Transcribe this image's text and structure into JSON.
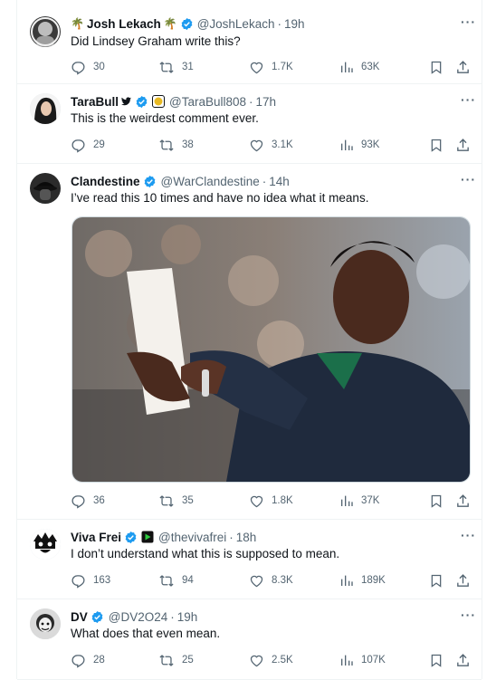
{
  "tweets": [
    {
      "name": "Josh Lekach",
      "name_prefix_emoji": "🌴",
      "name_suffix_emoji": "🌴",
      "handle": "@JoshLekach",
      "time": "19h",
      "text": "Did Lindsey Graham write this?",
      "replies": "30",
      "retweets": "31",
      "likes": "1.7K",
      "views": "63K"
    },
    {
      "name": "TaraBull",
      "handle": "@TaraBull808",
      "time": "17h",
      "text": "This is the weirdest comment ever.",
      "replies": "29",
      "retweets": "38",
      "likes": "3.1K",
      "views": "93K"
    },
    {
      "name": "Clandestine",
      "handle": "@WarClandestine",
      "time": "14h",
      "text": "I’ve read this 10 times and have no idea what it means.",
      "replies": "36",
      "retweets": "35",
      "likes": "1.8K",
      "views": "37K"
    },
    {
      "name": "Viva Frei",
      "handle": "@thevivafrei",
      "time": "18h",
      "text": "I don’t understand what this is supposed to mean.",
      "replies": "163",
      "retweets": "94",
      "likes": "8.3K",
      "views": "189K"
    },
    {
      "name": "DV",
      "handle": "@DV2O24",
      "time": "19h",
      "text": "What does that even mean.",
      "replies": "28",
      "retweets": "25",
      "likes": "2.5K",
      "views": "107K"
    }
  ],
  "separator": "·",
  "more_label": "···",
  "colors": {
    "verified_blue": "#1d9bf0",
    "gold_badge": "#e8b923",
    "text_secondary": "#536471",
    "border": "#eff3f4"
  },
  "icons": {
    "reply": "reply-icon",
    "retweet": "retweet-icon",
    "like": "like-icon",
    "views": "views-icon",
    "bookmark": "bookmark-icon",
    "share": "share-icon",
    "verified": "verified-badge-icon",
    "more": "more-icon"
  }
}
